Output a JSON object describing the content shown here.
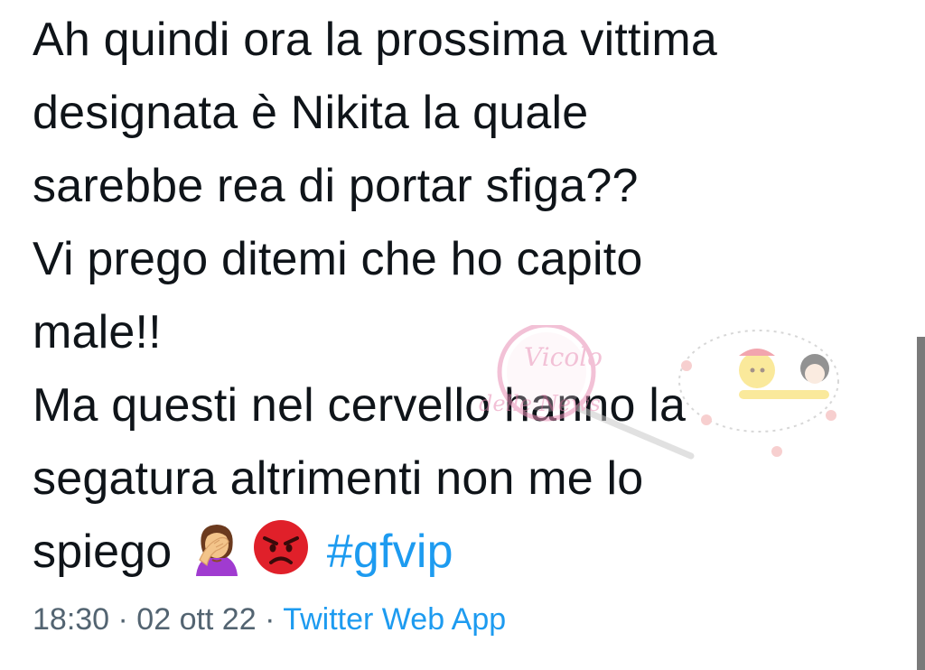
{
  "tweet": {
    "text_lines": [
      "Ah quindi ora la prossima vittima",
      "designata è Nikita la quale",
      "sarebbe rea di portar sfiga??",
      "Vi prego ditemi che ho capito",
      "male!!",
      "Ma questi nel cervello hanno la",
      "segatura altrimenti non me lo"
    ],
    "last_line_text": "spiego",
    "emoji_1": "woman-facepalming-emoji",
    "emoji_2": "angry-face-emoji",
    "hashtag": "#gfvip",
    "timestamp": "18:30 · 02 ott 22 · ",
    "source": "Twitter Web App"
  },
  "watermark": {
    "logo_text": "Vicolo delle News"
  },
  "colors": {
    "text": "#0f1419",
    "meta": "#536471",
    "link": "#1d9bf0",
    "scrollbar": "#7a7a7a"
  }
}
